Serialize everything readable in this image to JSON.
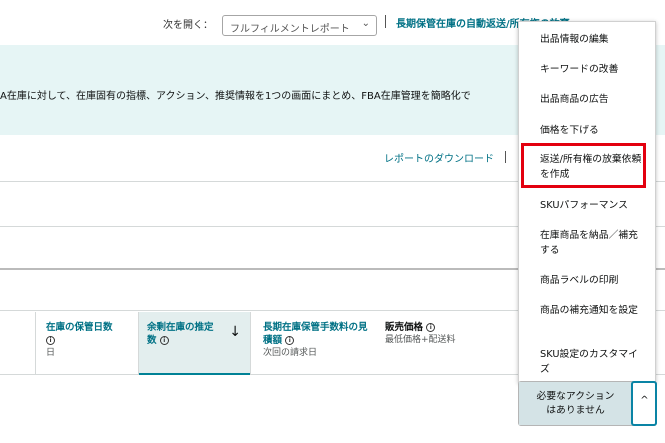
{
  "topbar": {
    "open_label": "次を開く：",
    "report_select_value": "フルフィルメントレポート",
    "link_long_term": "長期保管在庫の自動返送/所有権の放棄"
  },
  "banner": {
    "text": "A在庫に対して、在庫固有の指標、アクション、推奨情報を1つの画面にまとめ、FBA在庫管理を簡略化で"
  },
  "toolbar": {
    "download_link": "レポートのダウンロード"
  },
  "table": {
    "columns": [
      {
        "title": "在庫の保管日数",
        "info": "i",
        "sub": "日"
      },
      {
        "title": "余剰在庫の推定数",
        "info": "i",
        "sort": "↓"
      },
      {
        "title": "長期在庫保管手数料の見積額",
        "info": "i",
        "sub": "次回の請求日"
      },
      {
        "title": "販売価格",
        "info": "i",
        "sub": "最低価格+配送料"
      }
    ]
  },
  "menu": {
    "items": [
      "出品情報の編集",
      "キーワードの改善",
      "出品商品の広告",
      "価格を下げる",
      "返送/所有権の放棄依頼を作成",
      "SKUパフォーマンス",
      "在庫商品を納品／補充する",
      "商品ラベルの印刷",
      "商品の補充通知を設定",
      "SKU設定のカスタマイズ"
    ]
  },
  "action_button": {
    "label_line1": "必要なアクション",
    "label_line2": "はありません",
    "caret": "^"
  },
  "icons": {
    "select_chevron": "chevron-down-icon",
    "sort": "arrow-down-icon",
    "caret": "chevron-up-icon"
  },
  "colors": {
    "link": "#007185",
    "banner_bg": "#e6f5f5",
    "highlight": "#e3000f",
    "action_bg": "#d4e3e6"
  }
}
